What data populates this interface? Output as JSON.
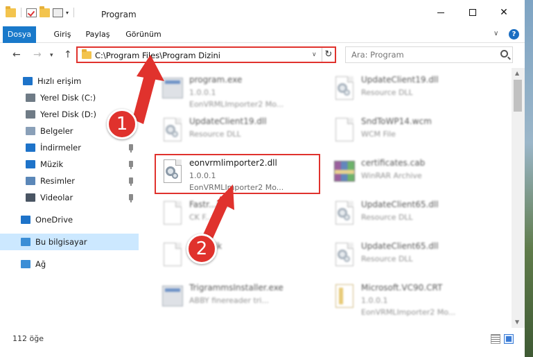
{
  "window": {
    "title": "Program",
    "controls": {
      "minimize": "",
      "maximize": "",
      "close": "✕"
    }
  },
  "ribbon": {
    "tabs": [
      {
        "label": "Dosya",
        "active": true
      },
      {
        "label": "Giriş",
        "active": false
      },
      {
        "label": "Paylaş",
        "active": false
      },
      {
        "label": "Görünüm",
        "active": false
      }
    ],
    "help_label": "?"
  },
  "nav": {
    "back": "←",
    "forward": "→",
    "recent": "▾",
    "up": "↑",
    "address": "C:\\Program Files\\Program Dizini",
    "refresh": "↻",
    "address_dropdown": "∨",
    "search_placeholder": "Ara: Program"
  },
  "sidebar": {
    "items": [
      {
        "label": "Hızlı erişim",
        "icon": "star-icon",
        "color": "#1e73c9",
        "pinned": false
      },
      {
        "label": "Yerel Disk (C:)",
        "icon": "drive-icon",
        "color": "#6f7b86",
        "pinned": false
      },
      {
        "label": "Yerel Disk (D:)",
        "icon": "drive-icon",
        "color": "#6f7b86",
        "pinned": false
      },
      {
        "label": "Belgeler",
        "icon": "documents-icon",
        "color": "#8aa0b8",
        "pinned": false
      },
      {
        "label": "İndirmeler",
        "icon": "download-icon",
        "color": "#1e73c9",
        "pinned": true
      },
      {
        "label": "Müzik",
        "icon": "music-icon",
        "color": "#1e73c9",
        "pinned": true
      },
      {
        "label": "Resimler",
        "icon": "pictures-icon",
        "color": "#5b87b8",
        "pinned": true
      },
      {
        "label": "Videolar",
        "icon": "videos-icon",
        "color": "#4a5563",
        "pinned": true
      },
      {
        "label": "OneDrive",
        "icon": "cloud-icon",
        "color": "#1e73c9",
        "pinned": false
      },
      {
        "label": "Bu bilgisayar",
        "icon": "computer-icon",
        "color": "#3b8ed6",
        "pinned": false,
        "selected": true
      },
      {
        "label": "Ağ",
        "icon": "network-icon",
        "color": "#3b8ed6",
        "pinned": false
      }
    ]
  },
  "files": [
    {
      "name": "program.exe",
      "line1": "1.0.0.1",
      "line2": "EonVRMLImporter2 Mo...",
      "icon": "exe-icon",
      "blurred": true
    },
    {
      "name": "UpdateClient19.dll",
      "line1": "Resource DLL",
      "line2": "",
      "icon": "dll-icon",
      "blurred": true
    },
    {
      "name": "eonvrmlimporter2.dll",
      "line1": "1.0.0.1",
      "line2": "EonVRMLImporter2 Mo...",
      "icon": "dll-icon",
      "blurred": false
    },
    {
      "name": "Fastr...jck",
      "line1": "CK F...",
      "line2": "",
      "icon": "doc-icon",
      "blurred": true
    },
    {
      "name": "...ml.cjk",
      "line1": "",
      "line2": "",
      "icon": "doc-icon",
      "blurred": true
    },
    {
      "name": "TrigrammsInstaller.exe",
      "line1": "ABBY finereader tri...",
      "line2": "",
      "icon": "exe-icon",
      "blurred": true
    },
    {
      "name": "UpdateClient19.dll",
      "line1": "Resource DLL",
      "line2": "",
      "icon": "dll-icon",
      "blurred": true
    },
    {
      "name": "SndToWP14.wcm",
      "line1": "WCM File",
      "line2": "",
      "icon": "doc-icon",
      "blurred": true
    },
    {
      "name": "certificates.cab",
      "line1": "WinRAR Archive",
      "line2": "",
      "icon": "archive-icon",
      "blurred": true
    },
    {
      "name": "UpdateClient65.dll",
      "line1": "Resource DLL",
      "line2": "",
      "icon": "dll-icon",
      "blurred": true
    },
    {
      "name": "UpdateClient65.dll",
      "line1": "Resource DLL",
      "line2": "",
      "icon": "dll-icon",
      "blurred": true
    },
    {
      "name": "Microsoft.VC90.CRT",
      "line1": "1.0.0.1",
      "line2": "EonVRMLImporter2 Mo...",
      "icon": "manifest-icon",
      "blurred": true
    }
  ],
  "annotations": {
    "step1": "1",
    "step2": "2",
    "color": "#e0322d"
  },
  "status": {
    "item_count": "112 öğe"
  }
}
